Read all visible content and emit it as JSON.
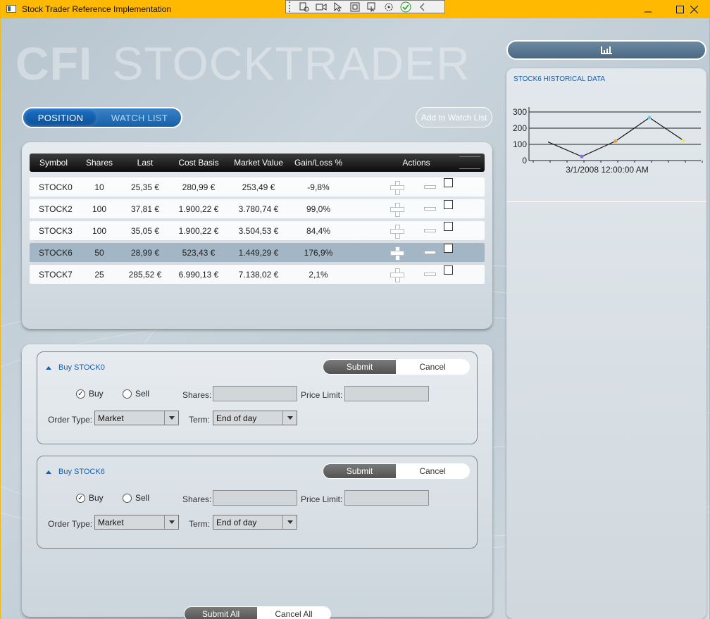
{
  "window": {
    "title": "Stock Trader Reference Implementation"
  },
  "logo": {
    "bold": "CFI",
    "light": "STOCKTRADER"
  },
  "tabs": [
    {
      "label": "POSITION",
      "active": true
    },
    {
      "label": "WATCH LIST",
      "active": false
    }
  ],
  "add_watch_label": "Add to Watch List",
  "positions": {
    "headers": [
      "Symbol",
      "Shares",
      "Last",
      "Cost Basis",
      "Market Value",
      "Gain/Loss %",
      "Actions"
    ],
    "rows": [
      {
        "symbol": "STOCK0",
        "shares": "10",
        "last": "25,35 €",
        "basis": "280,99 €",
        "mv": "253,49 €",
        "gain": "-9,8%",
        "selected": false
      },
      {
        "symbol": "STOCK2",
        "shares": "100",
        "last": "37,81 €",
        "basis": "1.900,22 €",
        "mv": "3.780,74 €",
        "gain": "99,0%",
        "selected": false
      },
      {
        "symbol": "STOCK3",
        "shares": "100",
        "last": "35,05 €",
        "basis": "1.900,22 €",
        "mv": "3.504,53 €",
        "gain": "84,4%",
        "selected": false
      },
      {
        "symbol": "STOCK6",
        "shares": "50",
        "last": "28,99 €",
        "basis": "523,43 €",
        "mv": "1.449,29 €",
        "gain": "176,9%",
        "selected": true
      },
      {
        "symbol": "STOCK7",
        "shares": "25",
        "last": "285,52 €",
        "basis": "6.990,13 €",
        "mv": "7.138,02 €",
        "gain": "2,1%",
        "selected": false
      }
    ]
  },
  "orders": [
    {
      "title": "Buy STOCK0",
      "submit_label": "Submit",
      "cancel_label": "Cancel",
      "buy_label": "Buy",
      "sell_label": "Sell",
      "buy_selected": true,
      "shares_label": "Shares:",
      "shares_value": "",
      "price_limit_label": "Price Limit:",
      "price_limit_value": "",
      "order_type_label": "Order Type:",
      "order_type_value": "Market",
      "term_label": "Term:",
      "term_value": "End of day"
    },
    {
      "title": "Buy STOCK6",
      "submit_label": "Submit",
      "cancel_label": "Cancel",
      "buy_label": "Buy",
      "sell_label": "Sell",
      "buy_selected": true,
      "shares_label": "Shares:",
      "shares_value": "",
      "price_limit_label": "Price Limit:",
      "price_limit_value": "",
      "order_type_label": "Order Type:",
      "order_type_value": "Market",
      "term_label": "Term:",
      "term_value": "End of day"
    }
  ],
  "footer": {
    "submit_all_label": "Submit All",
    "cancel_all_label": "Cancel All"
  },
  "history": {
    "title": "STOCK6 HISTORICAL DATA"
  },
  "chart_data": {
    "type": "line",
    "title": "",
    "yticks": [
      "300",
      "200",
      "100",
      "0"
    ],
    "ylim": [
      0,
      300
    ],
    "x_label": "3/1/2008 12:00:00 AM",
    "values": [
      115,
      25,
      120,
      265,
      125
    ],
    "point_colors": [
      "#111111",
      "#8a6bd6",
      "#e0a050",
      "#6ac8e0",
      "#e8e860"
    ],
    "line_color": "#111111"
  },
  "icons": {
    "chart_toggle": "bar-chart-icon",
    "buy_action": "plus-icon",
    "sell_action": "minus-icon"
  }
}
